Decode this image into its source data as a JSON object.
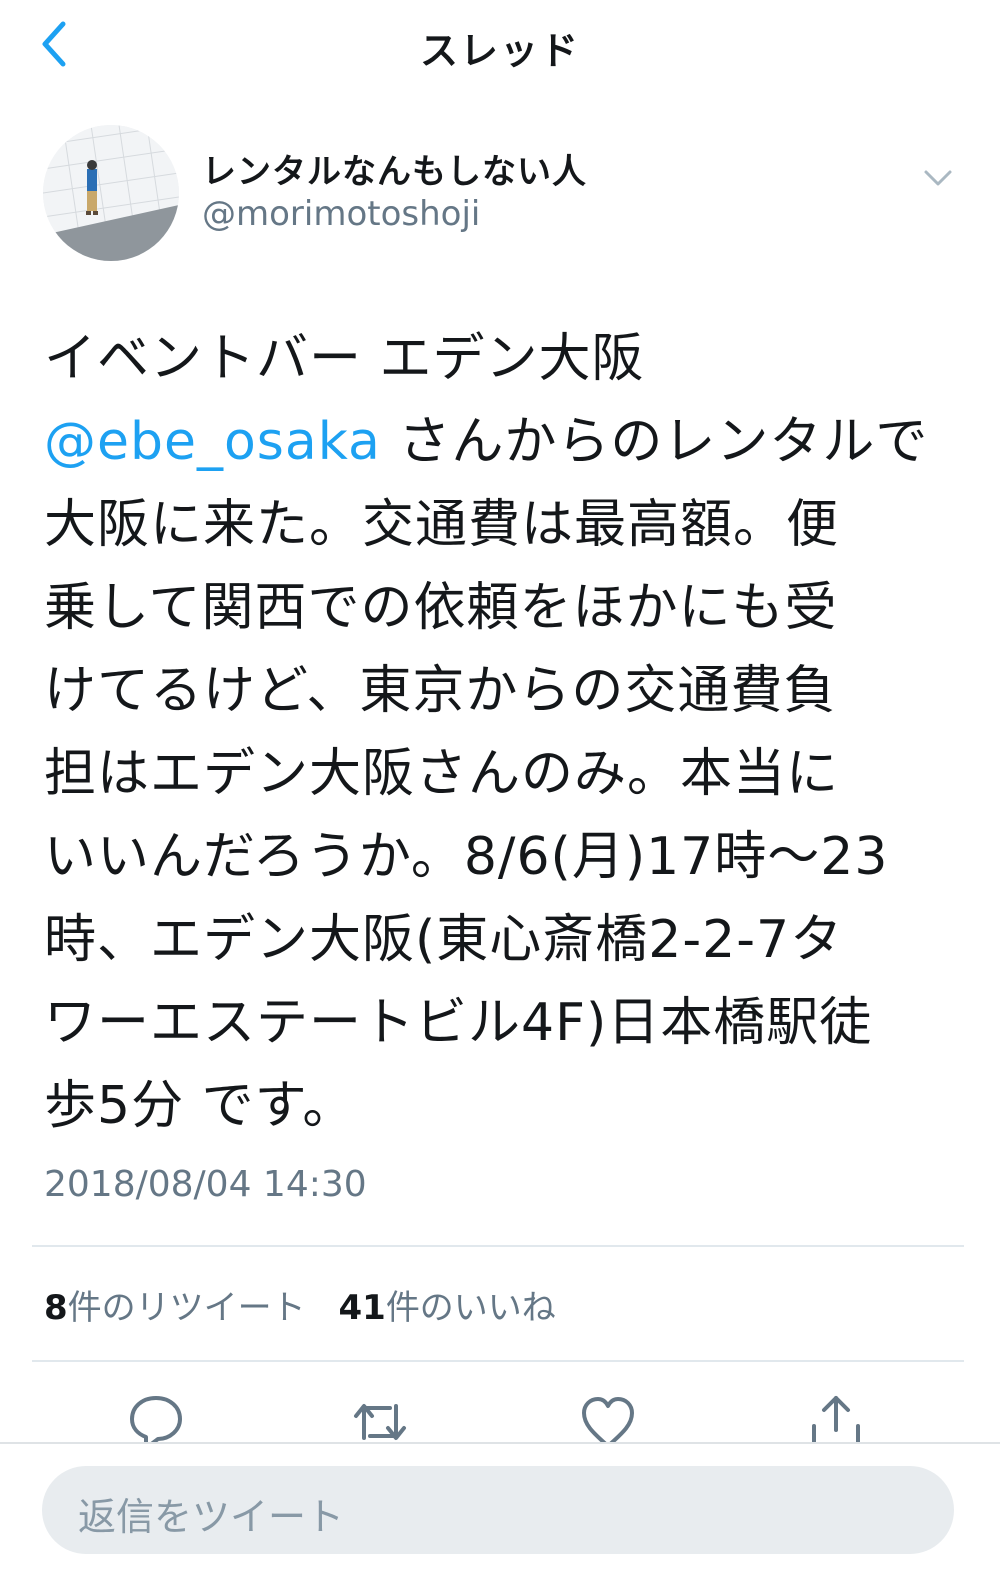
{
  "nav": {
    "title": "スレッド",
    "back_icon": "chevron-left-icon"
  },
  "author": {
    "display_name": "レンタルなんもしない人",
    "handle": "@morimotoshoji",
    "menu_icon": "chevron-down-icon"
  },
  "tweet": {
    "lines": [
      "イベントバー エデン大阪",
      {
        "mention": "@ebe_osaka",
        "after": " さんからのレンタルで"
      },
      "大阪に来た。交通費は最高額。便",
      "乗して関西での依頼をほかにも受",
      "けてるけど、東京からの交通費負",
      "担はエデン大阪さんのみ。本当に",
      "いいんだろうか。8/6(月)17時〜23",
      "時、エデン大阪(東心斎橋2-2-7タ",
      "ワーエステートビル4F)日本橋駅徒",
      "歩5分 です。"
    ],
    "timestamp": "2018/08/04 14:30"
  },
  "stats": {
    "retweets_count": "8",
    "retweets_label": "件のリツイート",
    "likes_count": "41",
    "likes_label": "件のいいね"
  },
  "actions": {
    "reply_icon": "reply-icon",
    "retweet_icon": "retweet-icon",
    "like_icon": "heart-icon",
    "share_icon": "share-icon"
  },
  "reply_bar": {
    "placeholder": "返信をツイート"
  },
  "colors": {
    "accent": "#1da1f2",
    "text": "#14171a",
    "secondary": "#657786",
    "divider": "#e1e8ed",
    "input_bg": "#e8ecef"
  }
}
